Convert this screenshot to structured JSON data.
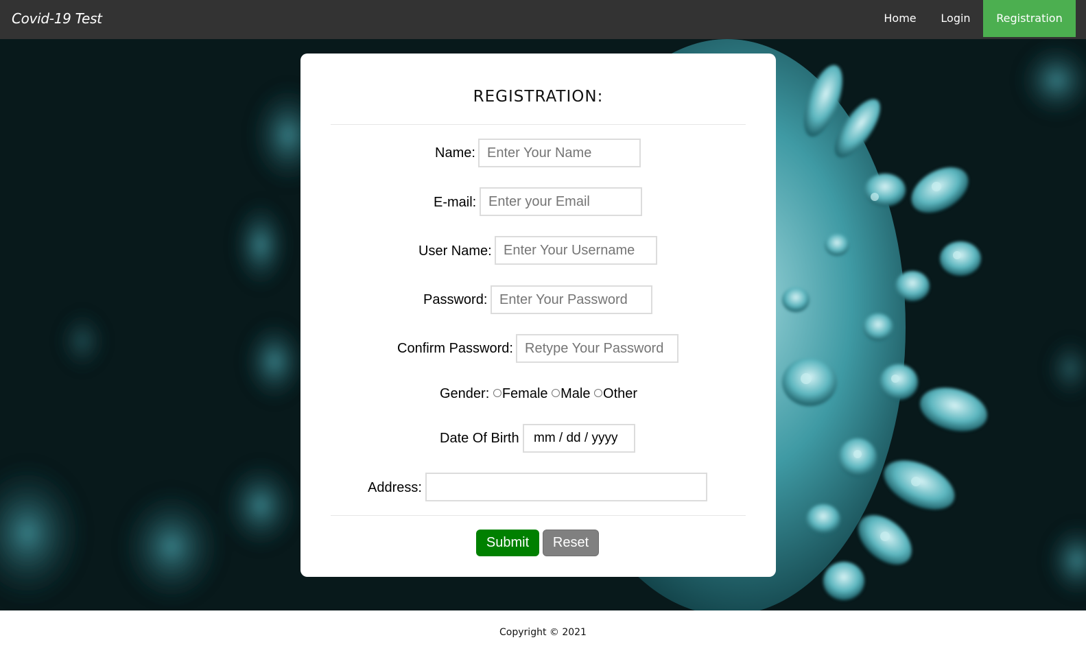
{
  "navbar": {
    "brand": "Covid-19 Test",
    "items": [
      {
        "label": "Home"
      },
      {
        "label": "Login"
      },
      {
        "label": "Registration",
        "active": true
      }
    ],
    "active_color": "#4caf50",
    "bar_color": "#333333"
  },
  "form": {
    "title": "REGISTRATION:",
    "name_label": "Name:",
    "name_placeholder": "Enter Your Name",
    "email_label": "E-mail:",
    "email_placeholder": "Enter your Email",
    "username_label": "User Name:",
    "username_placeholder": "Enter Your Username",
    "password_label": "Password:",
    "password_placeholder": "Enter Your Password",
    "confirm_label": "Confirm Password:",
    "confirm_placeholder": "Retype Your Password",
    "gender_label": "Gender:",
    "gender_options": [
      "Female",
      "Male",
      "Other"
    ],
    "dob_label": "Date Of Birth",
    "dob_placeholder": "mm / dd / yyyy",
    "address_label": "Address:",
    "address_value": "",
    "submit_label": "Submit",
    "reset_label": "Reset",
    "submit_color": "#008000",
    "reset_color": "#808080"
  },
  "footer": {
    "copyright": "Copyright © 2021"
  }
}
